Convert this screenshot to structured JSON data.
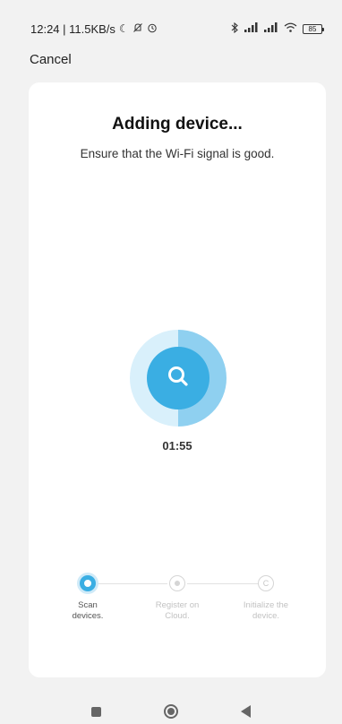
{
  "status_bar": {
    "time_speed": "12:24 | 11.5KB/s",
    "battery_level": "85"
  },
  "header": {
    "cancel_label": "Cancel"
  },
  "card": {
    "title": "Adding device...",
    "subtitle": "Ensure that the Wi-Fi signal is good.",
    "timer": "01:55",
    "scan_progress": 0.5
  },
  "steps": [
    {
      "label_line1": "Scan",
      "label_line2": "devices.",
      "state": "active"
    },
    {
      "label_line1": "Register on",
      "label_line2": "Cloud.",
      "state": "pending"
    },
    {
      "label_line1": "Initialize the",
      "label_line2": "device.",
      "state": "pending"
    }
  ],
  "colors": {
    "accent": "#3aaee3",
    "accent_light": "#8fd0f0",
    "accent_pale": "#d9f0fb"
  },
  "icons": {
    "status_left": [
      "moon-icon",
      "muted-bell-icon",
      "alarm-icon"
    ],
    "status_right": [
      "bluetooth-icon",
      "signal-icon",
      "signal-icon",
      "wifi-icon",
      "battery-icon"
    ],
    "scanner": "search-icon",
    "nav": [
      "recents-icon",
      "home-icon",
      "back-icon"
    ]
  }
}
